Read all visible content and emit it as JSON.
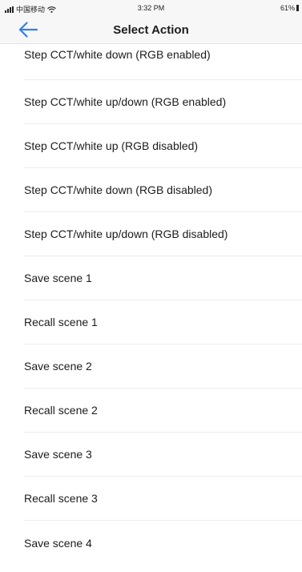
{
  "status_bar": {
    "carrier": "中国移动",
    "time": "3:32 PM",
    "battery": "61%"
  },
  "nav": {
    "title": "Select Action",
    "back_icon": "back-arrow-icon",
    "accent": "#2f80ed"
  },
  "actions": [
    {
      "label": "Step CCT/white down (RGB enabled)"
    },
    {
      "label": "Step CCT/white up/down (RGB enabled)"
    },
    {
      "label": "Step CCT/white up (RGB disabled)"
    },
    {
      "label": "Step CCT/white down (RGB disabled)"
    },
    {
      "label": "Step CCT/white up/down (RGB disabled)"
    },
    {
      "label": "Save scene 1"
    },
    {
      "label": "Recall scene 1"
    },
    {
      "label": "Save scene 2"
    },
    {
      "label": "Recall scene 2"
    },
    {
      "label": "Save scene 3"
    },
    {
      "label": "Recall scene 3"
    },
    {
      "label": "Save scene 4"
    }
  ]
}
